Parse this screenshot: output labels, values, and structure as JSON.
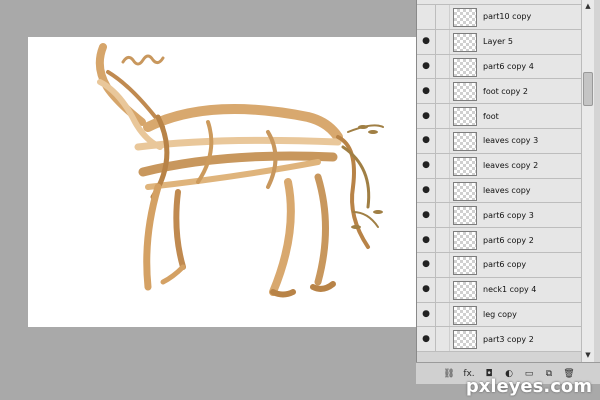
{
  "layers": [
    {
      "name": "part10 copy",
      "visible": false
    },
    {
      "name": "Layer 5",
      "visible": true
    },
    {
      "name": "part6 copy 4",
      "visible": true
    },
    {
      "name": "foot copy 2",
      "visible": true
    },
    {
      "name": "foot",
      "visible": true
    },
    {
      "name": "leaves copy 3",
      "visible": true
    },
    {
      "name": "leaves copy 2",
      "visible": true
    },
    {
      "name": "leaves copy",
      "visible": true
    },
    {
      "name": "part6 copy 3",
      "visible": true
    },
    {
      "name": "part6 copy 2",
      "visible": true
    },
    {
      "name": "part6 copy",
      "visible": true
    },
    {
      "name": "neck1 copy 4",
      "visible": true
    },
    {
      "name": "leg copy",
      "visible": true
    },
    {
      "name": "part3 copy 2",
      "visible": true
    }
  ],
  "icons": {
    "eye": "eye-icon",
    "link": "link-layers-icon",
    "fx": "fx-icon",
    "mask": "layer-mask-icon",
    "adjust": "adjustment-layer-icon",
    "group": "folder-icon",
    "new": "new-layer-icon",
    "trash": "trash-icon"
  },
  "toolbar": {
    "link": "⛓",
    "fx": "fx.",
    "mask": "◘",
    "adjust": "◐",
    "group": "▭",
    "new": "⧉",
    "trash": "🗑"
  },
  "watermark": "pxleyes.com",
  "colors": {
    "wood_light": "#e9c79a",
    "wood_mid": "#c8975d",
    "wood_dark": "#8a5a2b",
    "leaves": "#a07f44"
  }
}
